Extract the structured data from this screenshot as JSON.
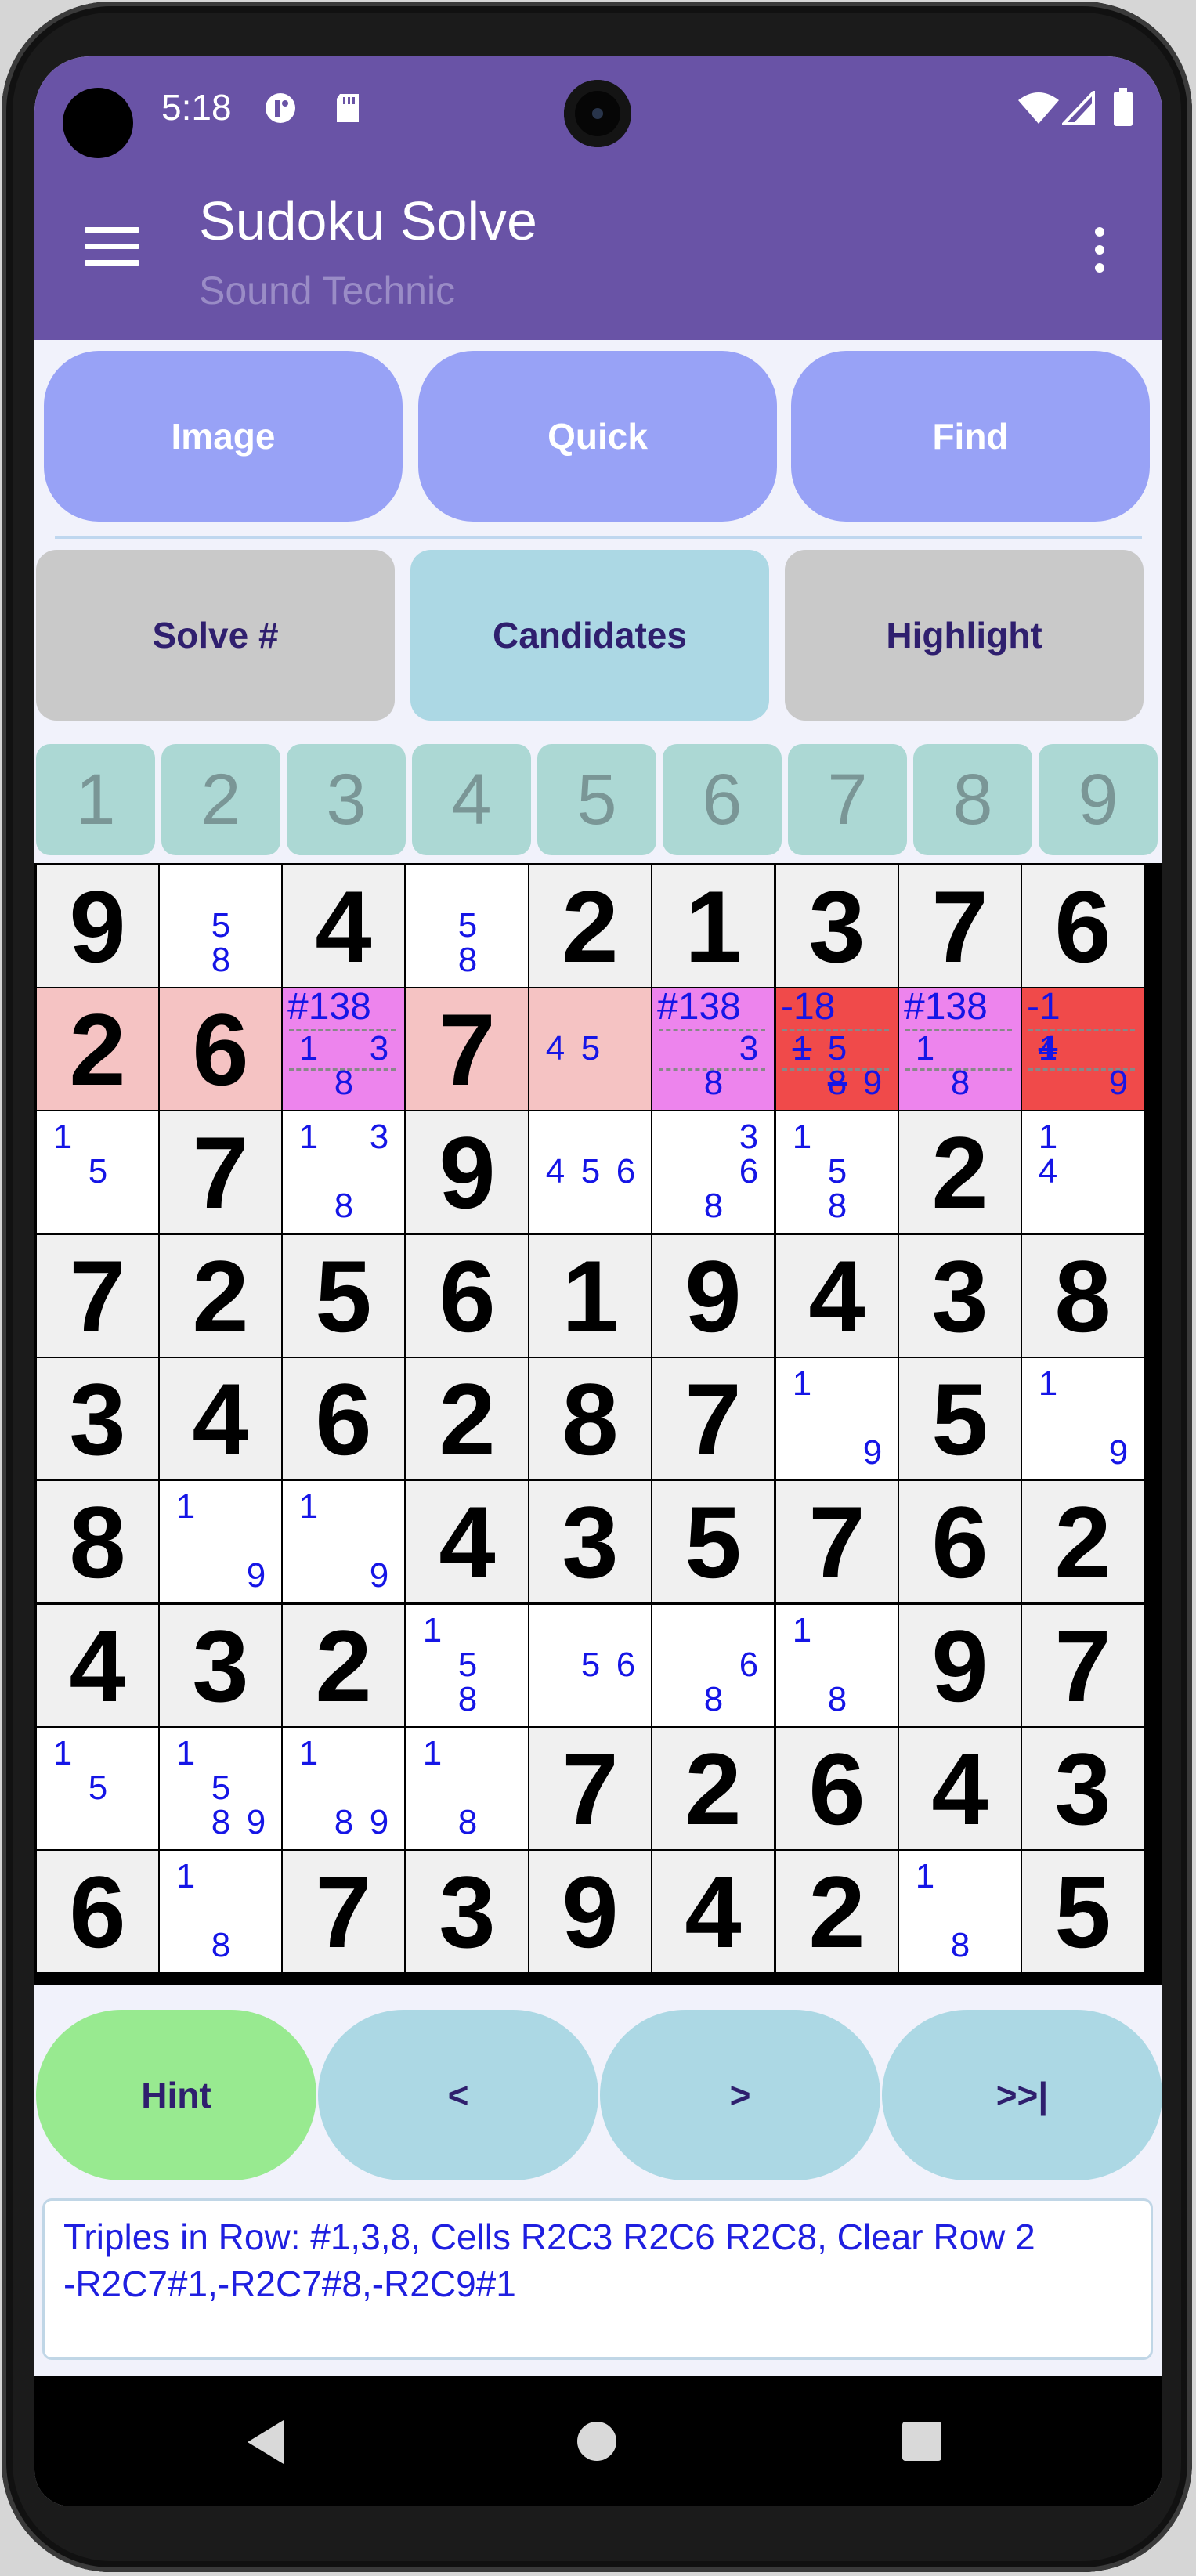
{
  "status": {
    "time": "5:18",
    "icons": [
      "app-icon",
      "sd-card-icon",
      "wifi-icon",
      "signal-icon",
      "battery-icon"
    ]
  },
  "app": {
    "title": "Sudoku Solve",
    "subtitle": "Sound Technic"
  },
  "top_buttons": [
    "Image",
    "Quick",
    "Find"
  ],
  "tabs": [
    {
      "label": "Solve #",
      "active": false
    },
    {
      "label": "Candidates",
      "active": true
    },
    {
      "label": "Highlight",
      "active": false
    }
  ],
  "number_buttons": [
    "1",
    "2",
    "3",
    "4",
    "5",
    "6",
    "7",
    "8",
    "9"
  ],
  "grid": {
    "colors": {
      "pink": "#f5c3c3",
      "magenta": "#ed84ed",
      "red": "#f04a4a",
      "given": "#f0f0f0",
      "empty": "#ffffff",
      "candidate": "#1515e6"
    },
    "cells": [
      [
        {
          "v": "9"
        },
        {
          "c": [
            "5",
            "8"
          ]
        },
        {
          "v": "4"
        },
        {
          "c": [
            "5",
            "8"
          ]
        },
        {
          "v": "2"
        },
        {
          "v": "1"
        },
        {
          "v": "3"
        },
        {
          "v": "7"
        },
        {
          "v": "6"
        }
      ],
      [
        {
          "v": "2",
          "bg": "pink"
        },
        {
          "v": "6",
          "bg": "pink"
        },
        {
          "c": [
            "1",
            "3",
            "8"
          ],
          "bg": "magenta",
          "tag": "#138",
          "dashed": true
        },
        {
          "v": "7",
          "bg": "pink"
        },
        {
          "c": [
            "4",
            "5"
          ],
          "bg": "pink"
        },
        {
          "c": [
            "3",
            "8"
          ],
          "bg": "magenta",
          "tag": "#138",
          "dashed": true
        },
        {
          "c": [
            "1",
            "5",
            "8",
            "9"
          ],
          "bg": "red",
          "tag": "-18",
          "struck": [
            "1",
            "8"
          ],
          "dashed": true
        },
        {
          "c": [
            "1",
            "8"
          ],
          "bg": "magenta",
          "tag": "#138",
          "dashed": true
        },
        {
          "c": [
            "1",
            "4",
            "9"
          ],
          "bg": "red",
          "tag": "-1",
          "struck": [
            "1"
          ],
          "dashed": true
        }
      ],
      [
        {
          "c": [
            "1",
            "5"
          ]
        },
        {
          "v": "7"
        },
        {
          "c": [
            "1",
            "3",
            "8"
          ]
        },
        {
          "v": "9"
        },
        {
          "c": [
            "4",
            "5",
            "6"
          ]
        },
        {
          "c": [
            "3",
            "6",
            "8"
          ]
        },
        {
          "c": [
            "1",
            "5",
            "8"
          ]
        },
        {
          "v": "2"
        },
        {
          "c": [
            "1",
            "4"
          ]
        }
      ],
      [
        {
          "v": "7"
        },
        {
          "v": "2"
        },
        {
          "v": "5"
        },
        {
          "v": "6"
        },
        {
          "v": "1"
        },
        {
          "v": "9"
        },
        {
          "v": "4"
        },
        {
          "v": "3"
        },
        {
          "v": "8"
        }
      ],
      [
        {
          "v": "3"
        },
        {
          "v": "4"
        },
        {
          "v": "6"
        },
        {
          "v": "2"
        },
        {
          "v": "8"
        },
        {
          "v": "7"
        },
        {
          "c": [
            "1",
            "9"
          ]
        },
        {
          "v": "5"
        },
        {
          "c": [
            "1",
            "9"
          ]
        }
      ],
      [
        {
          "v": "8"
        },
        {
          "c": [
            "1",
            "9"
          ]
        },
        {
          "c": [
            "1",
            "9"
          ]
        },
        {
          "v": "4"
        },
        {
          "v": "3"
        },
        {
          "v": "5"
        },
        {
          "v": "7"
        },
        {
          "v": "6"
        },
        {
          "v": "2"
        }
      ],
      [
        {
          "v": "4"
        },
        {
          "v": "3"
        },
        {
          "v": "2"
        },
        {
          "c": [
            "1",
            "5",
            "8"
          ]
        },
        {
          "c": [
            "5",
            "6"
          ]
        },
        {
          "c": [
            "6",
            "8"
          ]
        },
        {
          "c": [
            "1",
            "8"
          ]
        },
        {
          "v": "9"
        },
        {
          "v": "7"
        }
      ],
      [
        {
          "c": [
            "1",
            "5"
          ]
        },
        {
          "c": [
            "1",
            "5",
            "8",
            "9"
          ]
        },
        {
          "c": [
            "1",
            "8",
            "9"
          ]
        },
        {
          "c": [
            "1",
            "8"
          ]
        },
        {
          "v": "7"
        },
        {
          "v": "2"
        },
        {
          "v": "6"
        },
        {
          "v": "4"
        },
        {
          "v": "3"
        }
      ],
      [
        {
          "v": "6"
        },
        {
          "c": [
            "1",
            "8"
          ]
        },
        {
          "v": "7"
        },
        {
          "v": "3"
        },
        {
          "v": "9"
        },
        {
          "v": "4"
        },
        {
          "v": "2"
        },
        {
          "c": [
            "1",
            "8"
          ]
        },
        {
          "v": "5"
        }
      ]
    ]
  },
  "bottom_buttons": [
    {
      "label": "Hint",
      "color": "#98ea90"
    },
    {
      "label": "<",
      "color": "#acd8e4"
    },
    {
      "label": ">",
      "color": "#acd8e4"
    },
    {
      "label": ">>|",
      "color": "#acd8e4"
    }
  ],
  "message": {
    "line1": "Triples in Row: #1,3,8, Cells R2C3 R2C6 R2C8, Clear Row 2",
    "line2": "-R2C7#1,-R2C7#8,-R2C9#1"
  }
}
